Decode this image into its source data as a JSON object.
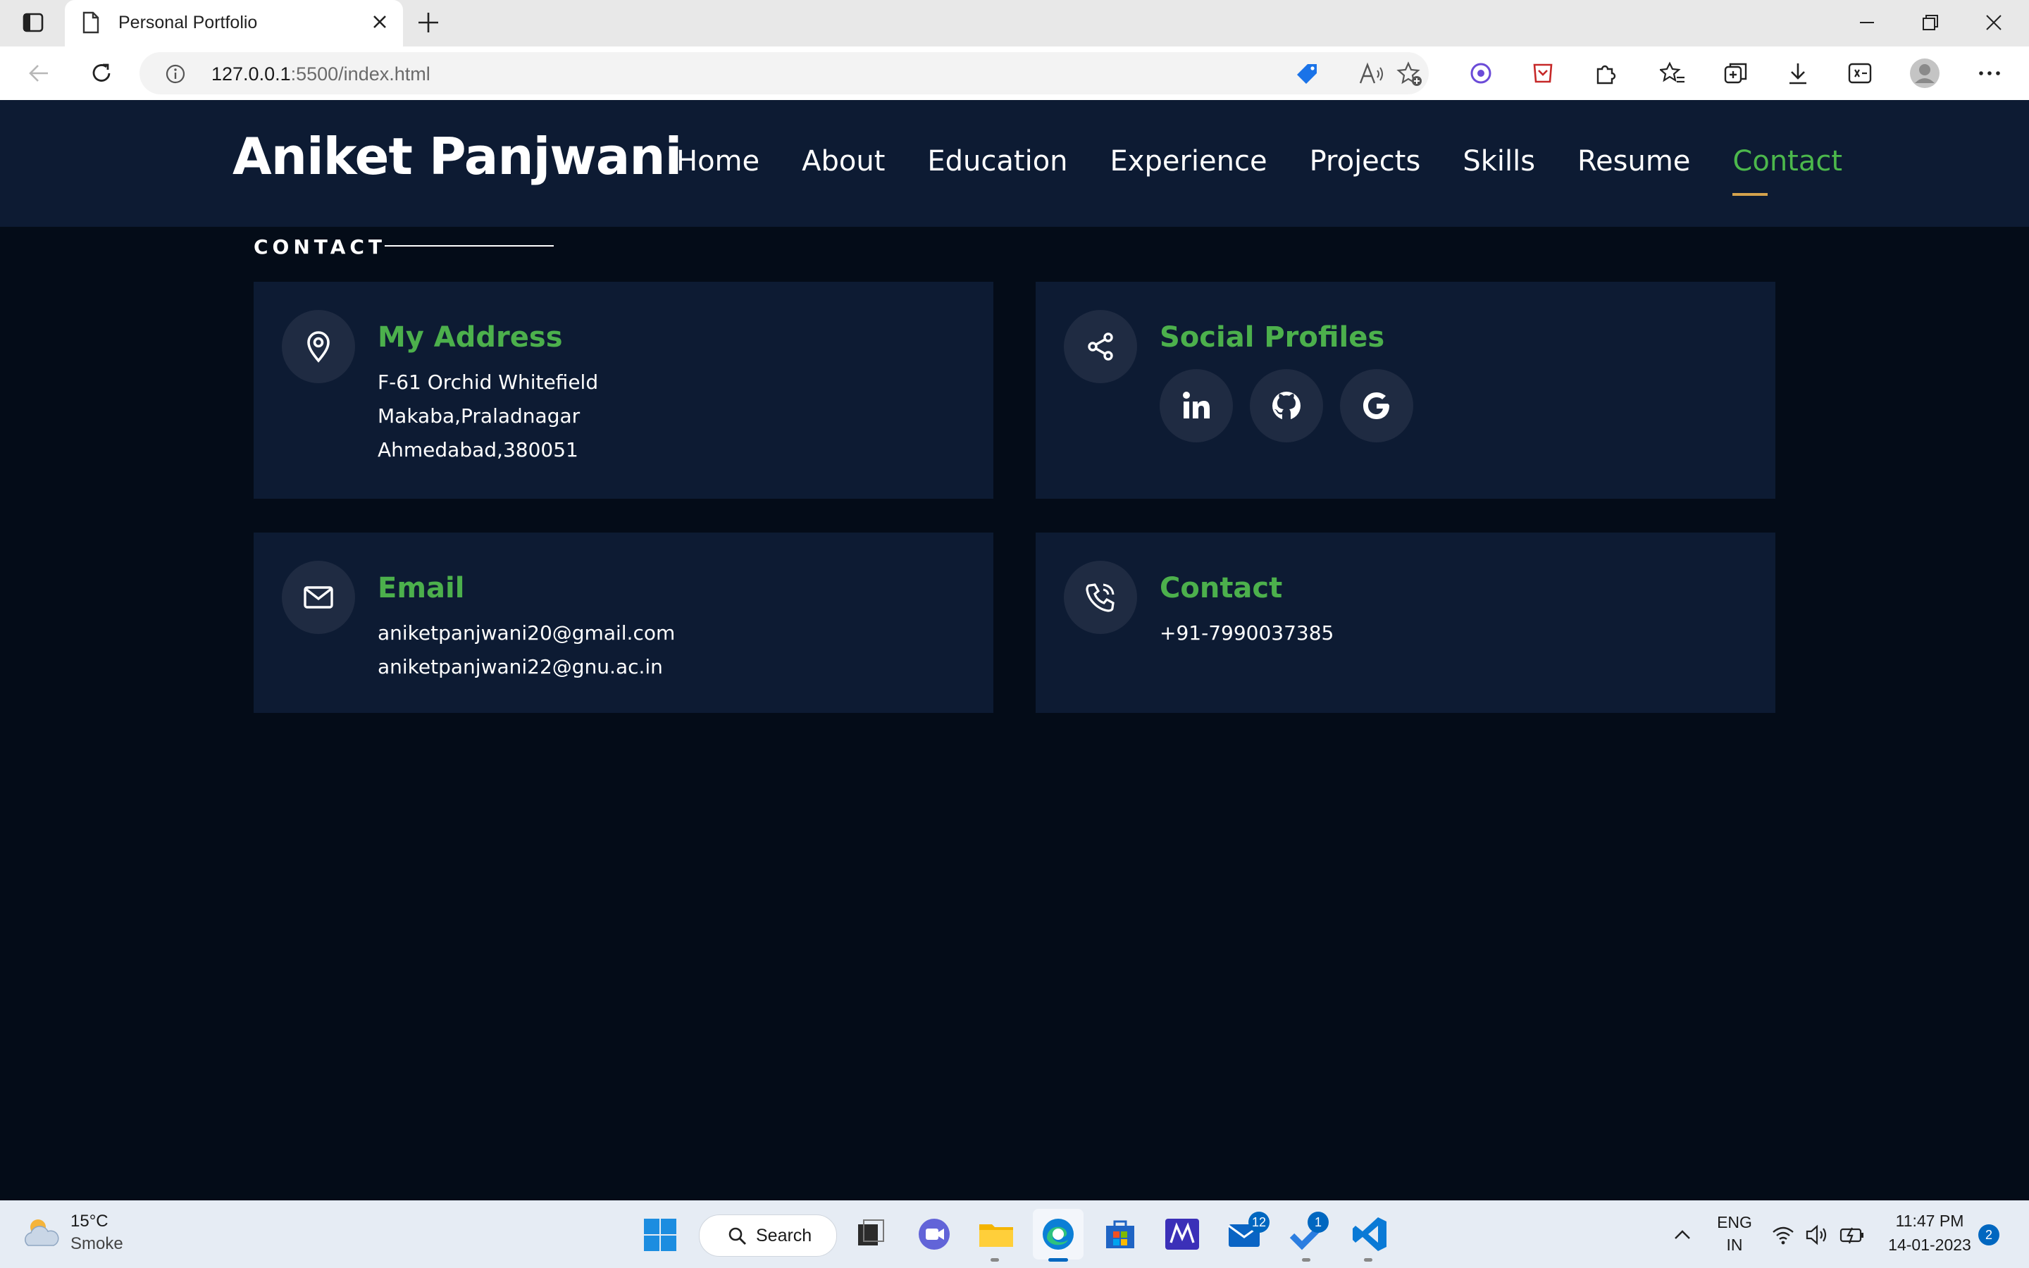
{
  "browser": {
    "tab_title": "Personal Portfolio",
    "address_host": "127.0.0.1",
    "address_rest": ":5500/index.html"
  },
  "site": {
    "brand": "Aniket Panjwani",
    "nav": [
      "Home",
      "About",
      "Education",
      "Experience",
      "Projects",
      "Skills",
      "Resume",
      "Contact"
    ],
    "active_nav": "Contact",
    "section_label": "CONTACT"
  },
  "cards": {
    "address": {
      "title": "My Address",
      "lines": [
        "F-61 Orchid Whitefield",
        "Makaba,Praladnagar",
        "Ahmedabad,380051"
      ]
    },
    "social": {
      "title": "Social Profiles",
      "profiles": [
        "linkedin-icon",
        "github-icon",
        "google-icon"
      ]
    },
    "email": {
      "title": "Email",
      "lines": [
        "aniketpanjwani20@gmail.com",
        "aniketpanjwani22@gnu.ac.in"
      ]
    },
    "contact": {
      "title": "Contact",
      "lines": [
        "+91-7990037385"
      ]
    }
  },
  "colors": {
    "header_bg": "#0d1b33",
    "page_bg": "#040c18",
    "accent_green": "#4cb04c",
    "underline": "#d4a24c"
  },
  "taskbar": {
    "weather_temp": "15°C",
    "weather_condition": "Smoke",
    "search_label": "Search",
    "mail_badge": "12",
    "todo_badge": "1",
    "lang_top": "ENG",
    "lang_bottom": "IN",
    "time": "11:47 PM",
    "date": "14-01-2023",
    "notification_count": "2"
  }
}
